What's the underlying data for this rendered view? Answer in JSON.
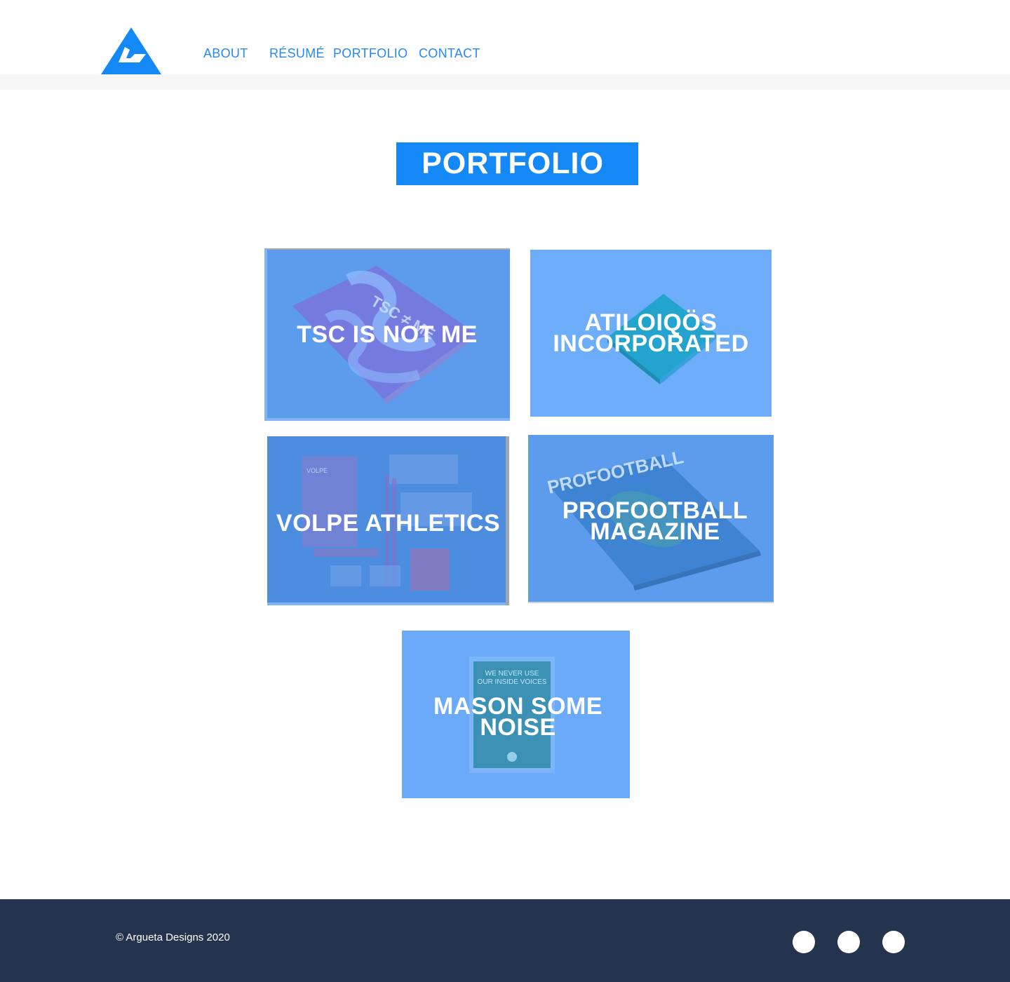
{
  "nav": {
    "items": [
      "ABOUT",
      "RÉSUMÉ",
      "PORTFOLIO",
      "CONTACT"
    ]
  },
  "page": {
    "title": "PORTFOLIO"
  },
  "projects": [
    {
      "title": "TSC IS NOT ME",
      "art_text": "TSC ≠ ME"
    },
    {
      "title": "ATILOIQÖS INCORPORATED"
    },
    {
      "title": "VOLPE ATHLETICS",
      "art_text": "VOLPE"
    },
    {
      "title": "PROFOOTBALL MAGAZINE",
      "art_text": "PROFOOTBALL"
    },
    {
      "title": "MASON SOME NOISE",
      "art_text": [
        "WE NEVER USE",
        "OUR INSIDE VOICES"
      ]
    }
  ],
  "footer": {
    "copyright": "© Argueta Designs 2020",
    "social_icons": [
      "social-icon-1",
      "social-icon-2",
      "social-icon-3"
    ]
  },
  "colors": {
    "brand_blue": "#1488f7",
    "nav_blue": "#2689f3",
    "card_overlay": "#6aaaf9",
    "footer_bg": "#24344f"
  }
}
